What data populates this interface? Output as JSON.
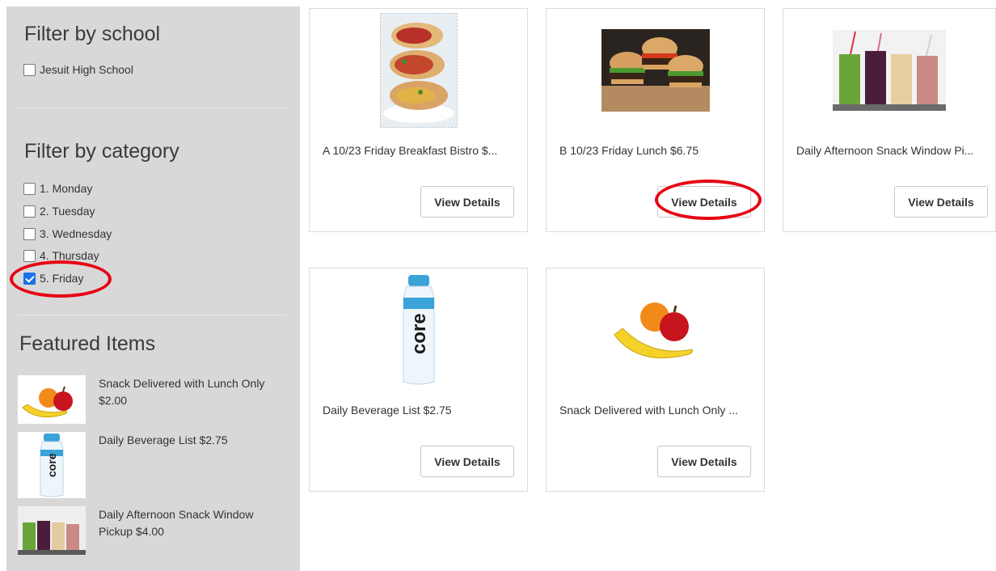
{
  "sidebar": {
    "school_heading": "Filter by school",
    "schools": [
      {
        "label": "Jesuit High School",
        "checked": false
      }
    ],
    "category_heading": "Filter by category",
    "categories": [
      {
        "label": "1. Monday",
        "checked": false
      },
      {
        "label": "2. Tuesday",
        "checked": false
      },
      {
        "label": "3. Wednesday",
        "checked": false
      },
      {
        "label": "4. Thursday",
        "checked": false
      },
      {
        "label": "5. Friday",
        "checked": true
      }
    ],
    "featured_heading": "Featured Items",
    "featured": [
      {
        "label": "Snack Delivered with Lunch Only $2.00",
        "image": "fruit-image"
      },
      {
        "label": "Daily Beverage List $2.75",
        "image": "water-bottle-image"
      },
      {
        "label": "Daily Afternoon Snack Window Pickup $4.00",
        "image": "smoothies-image"
      }
    ]
  },
  "products": [
    {
      "title": "A 10/23 Friday Breakfast Bistro $...",
      "button": "View Details",
      "image": "breakfast-wrap-image"
    },
    {
      "title": "B 10/23 Friday Lunch $6.75",
      "button": "View Details",
      "image": "sliders-image"
    },
    {
      "title": "Daily Afternoon Snack Window Pi...",
      "button": "View Details",
      "image": "smoothies-image"
    },
    {
      "title": "Daily Beverage List $2.75",
      "button": "View Details",
      "image": "water-bottle-image"
    },
    {
      "title": "Snack Delivered with Lunch Only ...",
      "button": "View Details",
      "image": "fruit-image"
    }
  ],
  "colors": {
    "sidebar_bg": "#d8d8d8",
    "annotation_red": "#e60012",
    "checkbox_checked": "#1a73e8"
  },
  "bottle_brand": "core"
}
